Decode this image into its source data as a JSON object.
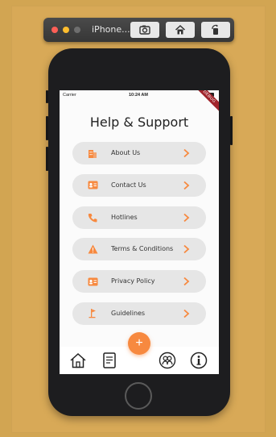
{
  "simulator": {
    "title": "iPhone...",
    "buttons": [
      "screenshot-icon",
      "home-icon",
      "rotate-icon"
    ]
  },
  "status_bar": {
    "carrier": "Carrier",
    "time": "10:24 AM"
  },
  "debug_banner": "DEBUG",
  "page": {
    "title": "Help & Support",
    "accent_color": "#f7893f"
  },
  "menu": [
    {
      "label": "About Us",
      "icon": "building-icon"
    },
    {
      "label": "Contact Us",
      "icon": "contact-card-icon"
    },
    {
      "label": "Hotlines",
      "icon": "phone-icon"
    },
    {
      "label": "Terms & Conditions",
      "icon": "warning-icon"
    },
    {
      "label": "Privacy Policy",
      "icon": "id-card-icon"
    },
    {
      "label": "Guidelines",
      "icon": "flag-icon"
    }
  ],
  "bottom_nav": {
    "items": [
      "home-icon",
      "document-icon",
      "people-icon",
      "info-icon"
    ],
    "fab_label": "+"
  }
}
